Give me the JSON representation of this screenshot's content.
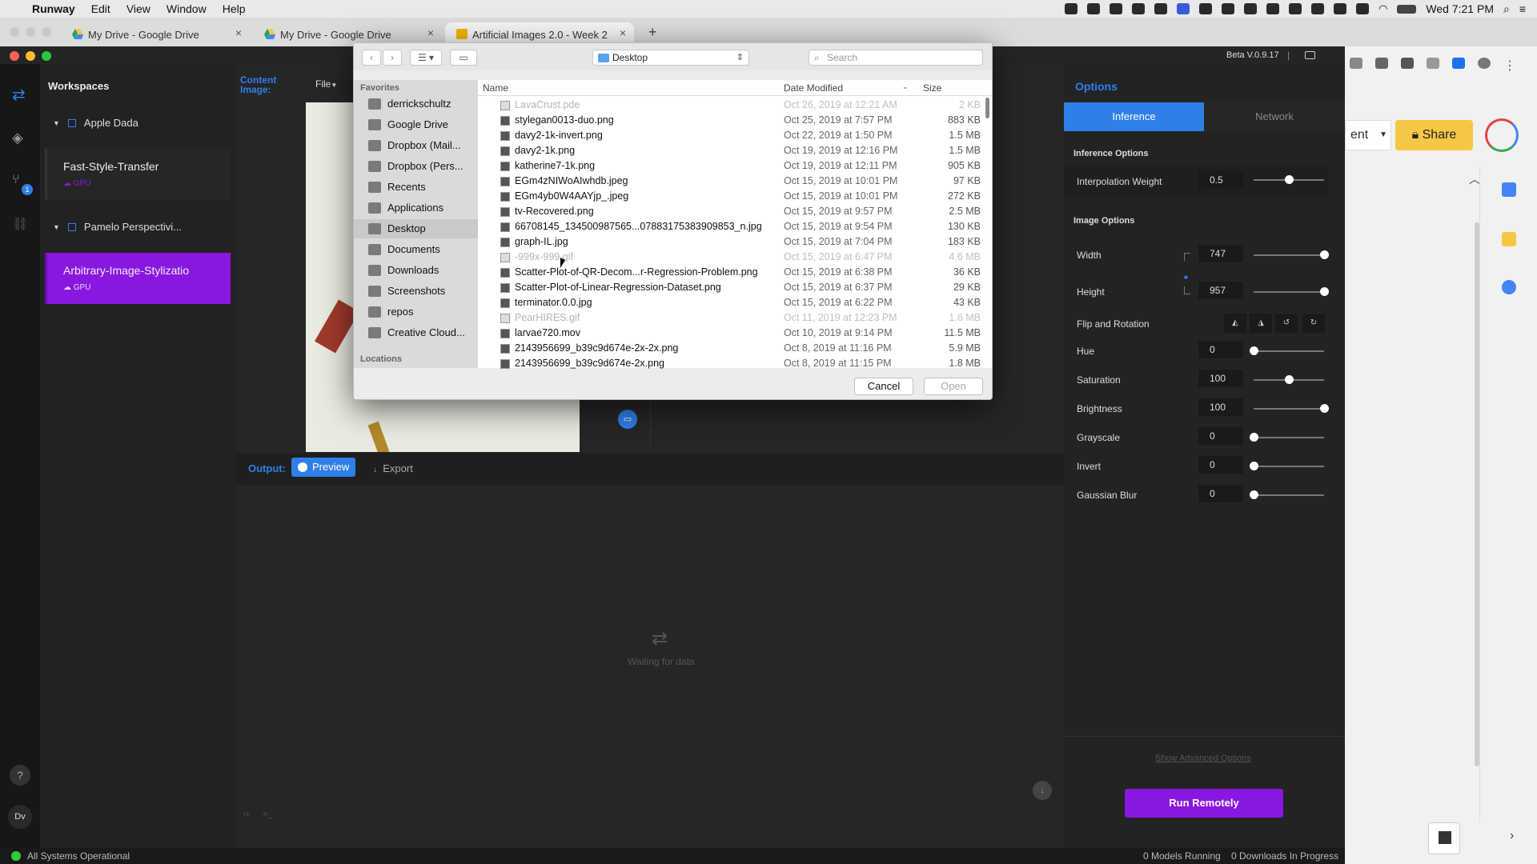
{
  "menubar": {
    "app_name": "Runway",
    "items": [
      "Edit",
      "View",
      "Window",
      "Help"
    ],
    "clock": "Wed 7:21 PM"
  },
  "browser_tabs": [
    {
      "label": "My Drive - Google Drive"
    },
    {
      "label": "My Drive - Google Drive"
    },
    {
      "label": "Artificial Images 2.0 - Week 2"
    }
  ],
  "chrome_partial": {
    "button_fragment": "ent",
    "share_label": "Share"
  },
  "runway": {
    "version": "Beta V.0.9.17",
    "workspaces_title": "Workspaces",
    "groups": [
      {
        "name": "Apple Dada",
        "model": "Fast-Style-Transfer",
        "badge": "GPU"
      },
      {
        "name": "Pamelo Perspectivi...",
        "model": "Arbitrary-Image-Stylizatio",
        "badge": "GPU"
      }
    ],
    "notification_count": "1",
    "user_initials": "Dv",
    "content_image_label": "Content Image:",
    "file_menu": "File",
    "output_label": "Output:",
    "preview_label": "Preview",
    "export_label": "Export",
    "waiting_text": "Waiting for data",
    "status_left": "All Systems Operational",
    "models_running": "0 Models Running",
    "downloads": "0 Downloads In Progress"
  },
  "dialog": {
    "location": "Desktop",
    "search_placeholder": "Search",
    "favorites_heading": "Favorites",
    "locations_heading": "Locations",
    "favorites": [
      "derrickschultz",
      "Google Drive",
      "Dropbox (Mail...",
      "Dropbox (Pers...",
      "Recents",
      "Applications",
      "Desktop",
      "Documents",
      "Downloads",
      "Screenshots",
      "repos",
      "Creative Cloud..."
    ],
    "selected_favorite": "Desktop",
    "columns": {
      "name": "Name",
      "date": "Date Modified",
      "size": "Size"
    },
    "files": [
      {
        "name": "LavaCrust.pde",
        "date": "Oct 26, 2019 at 12:21 AM",
        "size": "2 KB",
        "dim": true
      },
      {
        "name": "stylegan0013-duo.png",
        "date": "Oct 25, 2019 at 7:57 PM",
        "size": "883 KB",
        "dim": false
      },
      {
        "name": "davy2-1k-invert.png",
        "date": "Oct 22, 2019 at 1:50 PM",
        "size": "1.5 MB",
        "dim": false
      },
      {
        "name": "davy2-1k.png",
        "date": "Oct 19, 2019 at 12:16 PM",
        "size": "1.5 MB",
        "dim": false
      },
      {
        "name": "katherine7-1k.png",
        "date": "Oct 19, 2019 at 12:11 PM",
        "size": "905 KB",
        "dim": false
      },
      {
        "name": "EGm4zNIWoAIwhdb.jpeg",
        "date": "Oct 15, 2019 at 10:01 PM",
        "size": "97 KB",
        "dim": false
      },
      {
        "name": "EGm4yb0W4AAYjp_.jpeg",
        "date": "Oct 15, 2019 at 10:01 PM",
        "size": "272 KB",
        "dim": false
      },
      {
        "name": "tv-Recovered.png",
        "date": "Oct 15, 2019 at 9:57 PM",
        "size": "2.5 MB",
        "dim": false
      },
      {
        "name": "66708145_134500987565...07883175383909853_n.jpg",
        "date": "Oct 15, 2019 at 9:54 PM",
        "size": "130 KB",
        "dim": false
      },
      {
        "name": "graph-IL.jpg",
        "date": "Oct 15, 2019 at 7:04 PM",
        "size": "183 KB",
        "dim": false
      },
      {
        "name": "-999x-999.gif",
        "date": "Oct 15, 2019 at 6:47 PM",
        "size": "4.6 MB",
        "dim": true
      },
      {
        "name": "Scatter-Plot-of-QR-Decom...r-Regression-Problem.png",
        "date": "Oct 15, 2019 at 6:38 PM",
        "size": "36 KB",
        "dim": false
      },
      {
        "name": "Scatter-Plot-of-Linear-Regression-Dataset.png",
        "date": "Oct 15, 2019 at 6:37 PM",
        "size": "29 KB",
        "dim": false
      },
      {
        "name": "terminator.0.0.jpg",
        "date": "Oct 15, 2019 at 6:22 PM",
        "size": "43 KB",
        "dim": false
      },
      {
        "name": "PearHIRES.gif",
        "date": "Oct 11, 2019 at 12:23 PM",
        "size": "1.6 MB",
        "dim": true
      },
      {
        "name": "larvae720.mov",
        "date": "Oct 10, 2019 at 9:14 PM",
        "size": "11.5 MB",
        "dim": false
      },
      {
        "name": "2143956699_b39c9d674e-2x-2x.png",
        "date": "Oct 8, 2019 at 11:16 PM",
        "size": "5.9 MB",
        "dim": false
      },
      {
        "name": "2143956699_b39c9d674e-2x.png",
        "date": "Oct 8, 2019 at 11:15 PM",
        "size": "1.8 MB",
        "dim": false
      }
    ],
    "cancel_label": "Cancel",
    "open_label": "Open"
  },
  "options": {
    "title": "Options",
    "tab_inference": "Inference",
    "tab_network": "Network",
    "inference_heading": "Inference Options",
    "image_heading": "Image Options",
    "interpolation": {
      "label": "Interpolation Weight",
      "value": "0.5",
      "level": 0.5
    },
    "width": {
      "label": "Width",
      "value": "747",
      "level": 1.0
    },
    "height": {
      "label": "Height",
      "value": "957",
      "level": 1.0
    },
    "flip_label": "Flip and Rotation",
    "hue": {
      "label": "Hue",
      "value": "0",
      "level": 0.0
    },
    "saturation": {
      "label": "Saturation",
      "value": "100",
      "level": 0.5
    },
    "brightness": {
      "label": "Brightness",
      "value": "100",
      "level": 1.0
    },
    "grayscale": {
      "label": "Grayscale",
      "value": "0",
      "level": 0.0
    },
    "invert": {
      "label": "Invert",
      "value": "0",
      "level": 0.0
    },
    "blur": {
      "label": "Gaussian Blur",
      "value": "0",
      "level": 0.0
    },
    "advanced_link": "Show Advanced Options",
    "run_button": "Run Remotely"
  },
  "colors": {
    "accent_blue": "#2e7fe8",
    "accent_purple": "#8a17e0",
    "share_yellow": "#f6c744",
    "status_green": "#2ecc40"
  }
}
